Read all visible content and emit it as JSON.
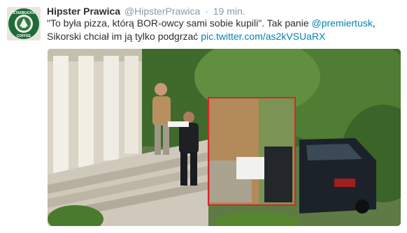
{
  "tweet": {
    "author_name": "Hipster Prawica",
    "author_handle": "@HipsterPrawica",
    "separator": "·",
    "time": "19 min.",
    "text_part1": "\"To była pizza, którą BOR-owcy sami sobie kupili\". Tak panie ",
    "mention": "@premiertusk",
    "text_part2": ",",
    "text_line2": "Sikorski chciał im ją tylko podgrzać ",
    "pic_link": "pic.twitter.com/as2kVSUaRX",
    "avatar_text_top": "STARBUCKS",
    "avatar_text_bottom": "COFFEE"
  },
  "colors": {
    "name": "#292f33",
    "meta": "#8899a6",
    "link": "#0084b4",
    "highlight_frame": "#d9262a"
  }
}
